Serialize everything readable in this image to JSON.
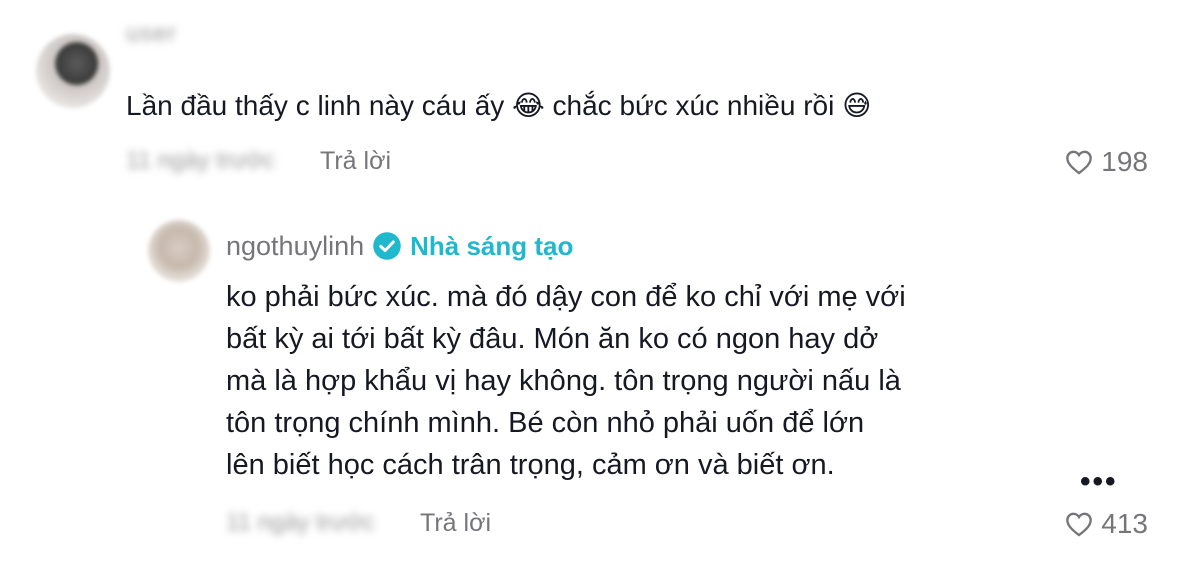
{
  "comment": {
    "username": "user",
    "text": "Lần đầu thấy c linh này cáu ấy 😂 chắc bức xúc nhiều rồi 😅",
    "timestamp": "11 ngày trước",
    "reply_label": "Trả lời",
    "like_count": "198"
  },
  "reply": {
    "username": "ngothuylinh",
    "creator_badge": "Nhà sáng tạo",
    "lines": [
      "ko phải bức xúc. mà đó dậy con để ko chỉ với mẹ với",
      "bất kỳ ai tới bất kỳ đâu. Món ăn ko có ngon hay dở",
      "mà là hợp khẩu vị hay không. tôn trọng người nấu là",
      "tôn trọng chính mình. Bé còn nhỏ phải uốn để lớn",
      "lên biết học cách trân trọng, cảm ơn và biết ơn."
    ],
    "timestamp": "11 ngày trước",
    "reply_label": "Trả lời",
    "like_count": "413",
    "more_label": "•••"
  },
  "colors": {
    "text": "#161823",
    "muted": "#75757a",
    "verified": "#20b8cd"
  },
  "icons": {
    "like": "heart-outline-icon",
    "verified": "verified-check-icon",
    "more": "more-dots-icon"
  }
}
